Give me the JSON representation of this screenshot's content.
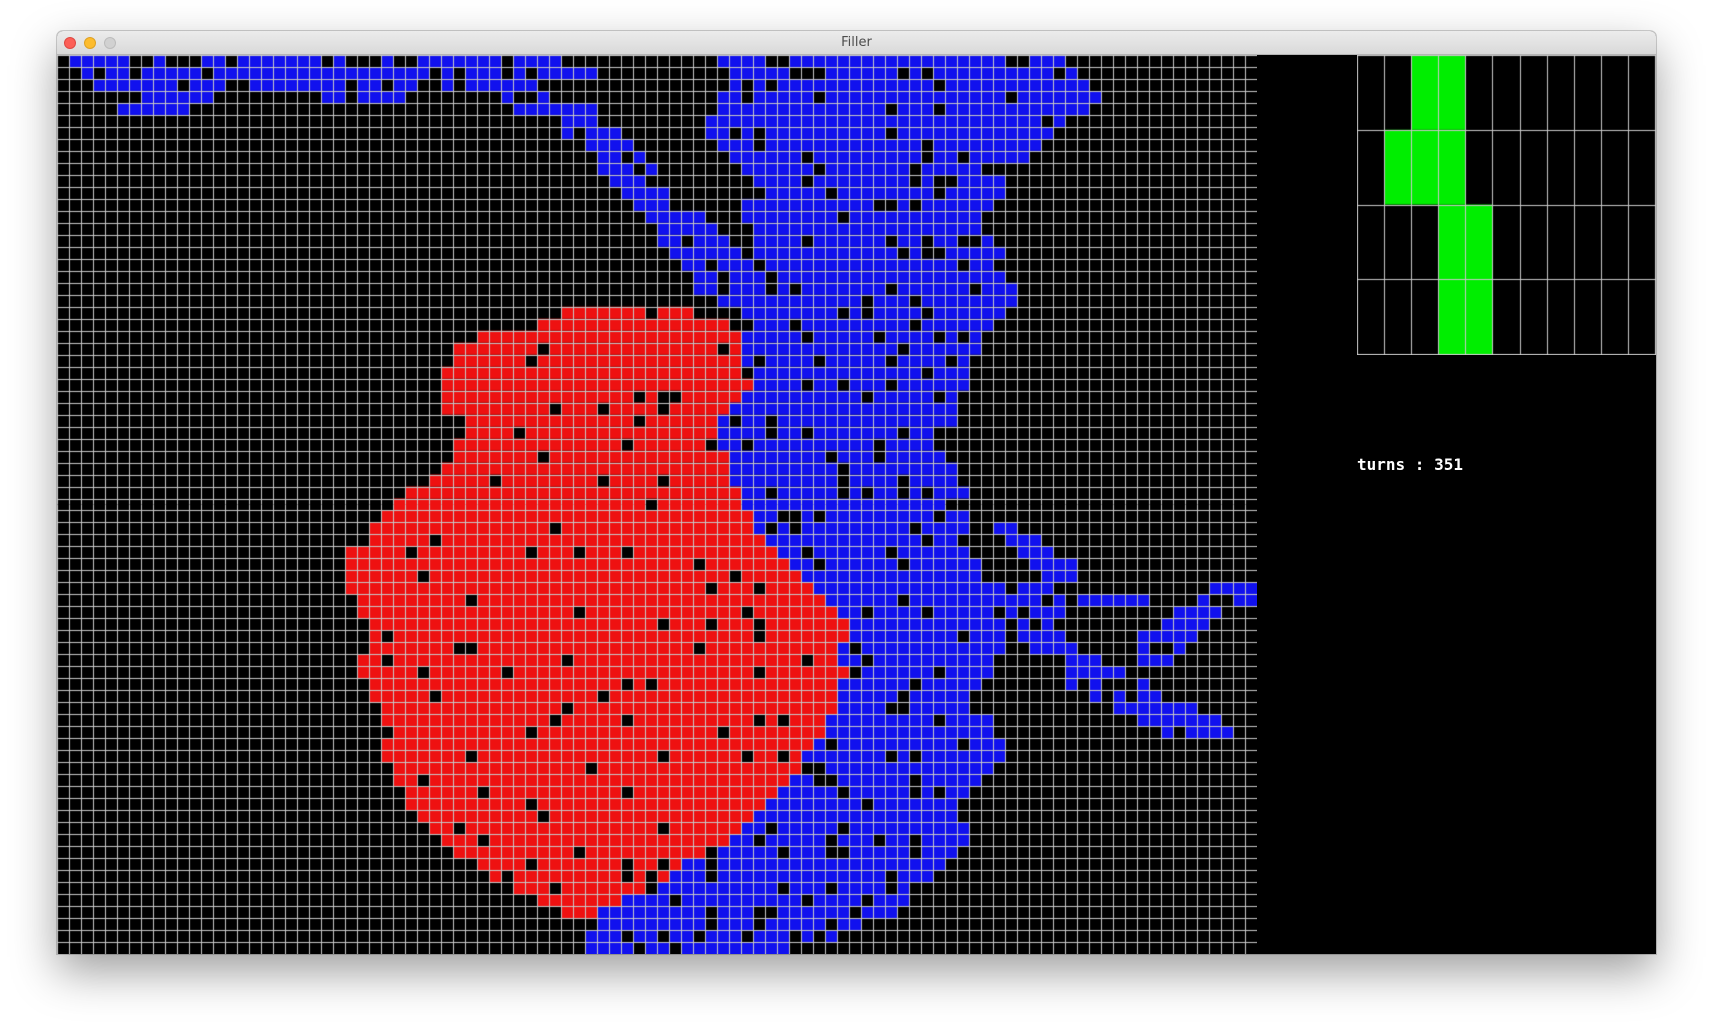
{
  "window": {
    "title": "Filler"
  },
  "board": {
    "rows": 75,
    "cols": 100,
    "colors": {
      "empty": "#000000",
      "grid": "#c8c8c8",
      "player_red": "#ee1111",
      "player_blue": "#1111ee"
    },
    "red_territory": [
      [
        21,
        42,
        52
      ],
      [
        22,
        40,
        55
      ],
      [
        23,
        35,
        56
      ],
      [
        24,
        33,
        56
      ],
      [
        25,
        33,
        56
      ],
      [
        26,
        32,
        57
      ],
      [
        27,
        32,
        57
      ],
      [
        28,
        32,
        56
      ],
      [
        29,
        32,
        55
      ],
      [
        30,
        34,
        54
      ],
      [
        31,
        34,
        54
      ],
      [
        32,
        33,
        54
      ],
      [
        33,
        33,
        55
      ],
      [
        34,
        32,
        55
      ],
      [
        35,
        31,
        55
      ],
      [
        36,
        29,
        56
      ],
      [
        37,
        28,
        56
      ],
      [
        38,
        27,
        57
      ],
      [
        39,
        26,
        57
      ],
      [
        40,
        25,
        58
      ],
      [
        41,
        24,
        59
      ],
      [
        42,
        24,
        60
      ],
      [
        43,
        24,
        61
      ],
      [
        44,
        24,
        62
      ],
      [
        45,
        25,
        63
      ],
      [
        46,
        25,
        64
      ],
      [
        47,
        26,
        65
      ],
      [
        48,
        26,
        65
      ],
      [
        49,
        26,
        64
      ],
      [
        50,
        25,
        64
      ],
      [
        51,
        25,
        65
      ],
      [
        52,
        26,
        64
      ],
      [
        53,
        26,
        64
      ],
      [
        54,
        27,
        64
      ],
      [
        55,
        27,
        63
      ],
      [
        56,
        27,
        63
      ],
      [
        57,
        27,
        62
      ],
      [
        58,
        27,
        61
      ],
      [
        59,
        28,
        61
      ],
      [
        60,
        28,
        60
      ],
      [
        61,
        29,
        59
      ],
      [
        62,
        29,
        58
      ],
      [
        63,
        30,
        57
      ],
      [
        64,
        31,
        56
      ],
      [
        65,
        32,
        55
      ],
      [
        66,
        33,
        53
      ],
      [
        67,
        35,
        51
      ],
      [
        68,
        36,
        50
      ],
      [
        69,
        38,
        48
      ],
      [
        70,
        40,
        46
      ],
      [
        71,
        42,
        44
      ]
    ],
    "blue_territory": [
      [
        0,
        55,
        83
      ],
      [
        1,
        56,
        84
      ],
      [
        2,
        56,
        85
      ],
      [
        3,
        55,
        86
      ],
      [
        4,
        55,
        85
      ],
      [
        5,
        54,
        84
      ],
      [
        6,
        54,
        82
      ],
      [
        7,
        55,
        81
      ],
      [
        8,
        56,
        80
      ],
      [
        9,
        57,
        79
      ],
      [
        10,
        58,
        79
      ],
      [
        11,
        58,
        78
      ],
      [
        12,
        57,
        77
      ],
      [
        13,
        56,
        76
      ],
      [
        14,
        57,
        76
      ],
      [
        15,
        58,
        77
      ],
      [
        16,
        58,
        78
      ],
      [
        17,
        59,
        77
      ],
      [
        18,
        60,
        78
      ],
      [
        19,
        60,
        79
      ],
      [
        20,
        59,
        79
      ],
      [
        21,
        57,
        78
      ],
      [
        22,
        57,
        77
      ],
      [
        23,
        56,
        76
      ],
      [
        24,
        56,
        76
      ],
      [
        25,
        55,
        75
      ],
      [
        26,
        55,
        75
      ],
      [
        27,
        56,
        75
      ],
      [
        28,
        56,
        74
      ],
      [
        29,
        56,
        74
      ],
      [
        30,
        55,
        74
      ],
      [
        31,
        55,
        73
      ],
      [
        32,
        55,
        72
      ],
      [
        33,
        56,
        73
      ],
      [
        34,
        56,
        74
      ],
      [
        35,
        55,
        74
      ],
      [
        36,
        55,
        75
      ],
      [
        37,
        56,
        75
      ],
      [
        38,
        57,
        75
      ],
      [
        39,
        58,
        75
      ],
      [
        40,
        58,
        74
      ],
      [
        41,
        59,
        75
      ],
      [
        42,
        60,
        76
      ],
      [
        43,
        61,
        77
      ],
      [
        44,
        62,
        77
      ],
      [
        45,
        63,
        78
      ],
      [
        46,
        63,
        79
      ],
      [
        47,
        64,
        78
      ],
      [
        48,
        64,
        78
      ],
      [
        49,
        63,
        78
      ],
      [
        50,
        63,
        78
      ],
      [
        51,
        62,
        77
      ],
      [
        52,
        62,
        76
      ],
      [
        53,
        62,
        76
      ],
      [
        54,
        61,
        76
      ],
      [
        55,
        61,
        77
      ],
      [
        56,
        60,
        77
      ],
      [
        57,
        60,
        78
      ],
      [
        58,
        60,
        78
      ],
      [
        59,
        59,
        77
      ],
      [
        60,
        59,
        76
      ],
      [
        61,
        58,
        75
      ],
      [
        62,
        57,
        74
      ],
      [
        63,
        57,
        74
      ],
      [
        64,
        56,
        75
      ],
      [
        65,
        55,
        75
      ],
      [
        66,
        54,
        74
      ],
      [
        67,
        52,
        73
      ],
      [
        68,
        50,
        72
      ],
      [
        69,
        47,
        70
      ],
      [
        70,
        46,
        70
      ],
      [
        71,
        45,
        69
      ],
      [
        72,
        45,
        66
      ],
      [
        73,
        44,
        64
      ],
      [
        74,
        44,
        60
      ]
    ],
    "blue_arms": [
      [
        0,
        0,
        8
      ],
      [
        1,
        2,
        30
      ],
      [
        2,
        3,
        14
      ],
      [
        2,
        16,
        32
      ],
      [
        3,
        7,
        12
      ],
      [
        3,
        22,
        28
      ],
      [
        4,
        5,
        10
      ],
      [
        0,
        10,
        40
      ],
      [
        1,
        32,
        38
      ],
      [
        2,
        34,
        40
      ],
      [
        3,
        36,
        40
      ],
      [
        4,
        38,
        44
      ],
      [
        5,
        40,
        44
      ],
      [
        6,
        42,
        46
      ],
      [
        7,
        44,
        47
      ],
      [
        8,
        45,
        48
      ],
      [
        9,
        45,
        49
      ],
      [
        10,
        46,
        50
      ],
      [
        11,
        47,
        51
      ],
      [
        12,
        48,
        52
      ],
      [
        13,
        49,
        53
      ],
      [
        14,
        50,
        54
      ],
      [
        15,
        50,
        55
      ],
      [
        16,
        51,
        56
      ],
      [
        17,
        52,
        57
      ],
      [
        18,
        53,
        58
      ],
      [
        19,
        53,
        58
      ],
      [
        20,
        54,
        58
      ],
      [
        0,
        34,
        41
      ],
      [
        1,
        38,
        44
      ],
      [
        39,
        78,
        80
      ],
      [
        40,
        79,
        81
      ],
      [
        41,
        80,
        82
      ],
      [
        42,
        81,
        84
      ],
      [
        43,
        82,
        84
      ],
      [
        44,
        78,
        84
      ],
      [
        45,
        76,
        90
      ],
      [
        46,
        78,
        84
      ],
      [
        47,
        80,
        82
      ],
      [
        48,
        80,
        83
      ],
      [
        49,
        81,
        84
      ],
      [
        50,
        82,
        86
      ],
      [
        51,
        83,
        88
      ],
      [
        52,
        84,
        90
      ],
      [
        53,
        86,
        92
      ],
      [
        54,
        88,
        94
      ],
      [
        55,
        90,
        96
      ],
      [
        56,
        92,
        97
      ],
      [
        45,
        95,
        100
      ],
      [
        44,
        96,
        100
      ],
      [
        46,
        93,
        97
      ],
      [
        47,
        91,
        95
      ],
      [
        48,
        90,
        94
      ],
      [
        49,
        90,
        93
      ],
      [
        50,
        90,
        92
      ]
    ]
  },
  "piece": {
    "rows": 4,
    "cols": 11,
    "color": "#00ee00",
    "grid_color": "#c8c8c8",
    "cells": [
      [
        0,
        2
      ],
      [
        0,
        3
      ],
      [
        1,
        1
      ],
      [
        1,
        2
      ],
      [
        1,
        3
      ],
      [
        2,
        3
      ],
      [
        2,
        4
      ],
      [
        3,
        3
      ],
      [
        3,
        4
      ]
    ]
  },
  "status": {
    "turns_label": "turns : 351"
  }
}
